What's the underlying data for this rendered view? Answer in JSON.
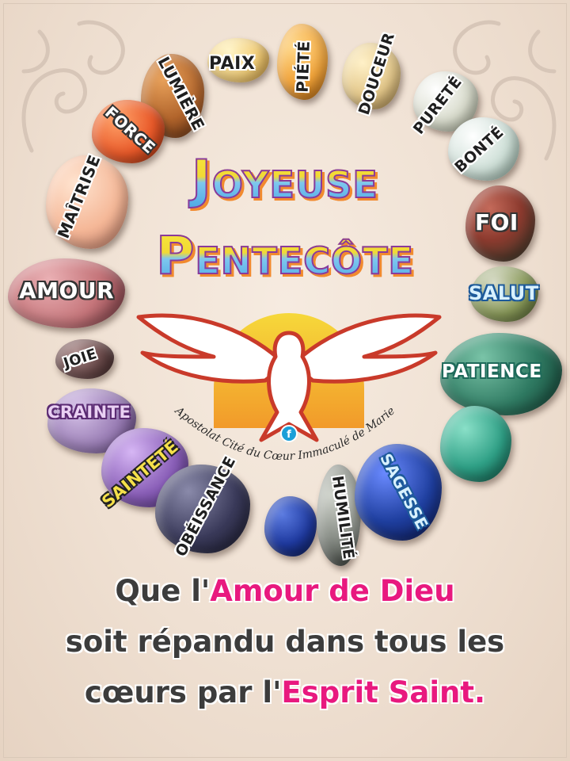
{
  "title": {
    "line1": "Joyeuse",
    "line2": "Pentecôte"
  },
  "organization": "Apostolat Cité du Cœur Immaculé de Marie",
  "virtues": [
    {
      "key": "paix",
      "label": "PAIX",
      "color": "#f3cf7a"
    },
    {
      "key": "piete",
      "label": "PIÉTÉ",
      "color": "#f2a43a"
    },
    {
      "key": "douceur",
      "label": "DOUCEUR",
      "color": "#e3c78a"
    },
    {
      "key": "lumiere",
      "label": "LUMIÈRE",
      "color": "#b2652c"
    },
    {
      "key": "force",
      "label": "FORCE",
      "color": "#e95a2a"
    },
    {
      "key": "purete",
      "label": "PURETÉ",
      "color": "#d9dccd"
    },
    {
      "key": "bonte",
      "label": "BONTÉ",
      "color": "#cfe0d8"
    },
    {
      "key": "maitrise",
      "label": "MAÎTRISE",
      "color": "#f5b898"
    },
    {
      "key": "foi",
      "label": "FOI",
      "color": "#8c3a2e"
    },
    {
      "key": "salut",
      "label": "SALUT",
      "color": "#8a9a5a"
    },
    {
      "key": "amour",
      "label": "AMOUR",
      "color": "#c5757a"
    },
    {
      "key": "joie",
      "label": "JOIE",
      "color": "#6a4a4a"
    },
    {
      "key": "patience",
      "label": "PATIENCE",
      "color": "#2f7a62"
    },
    {
      "key": "crainte",
      "label": "CRAINTE",
      "color": "#9b7fb6"
    },
    {
      "key": "saintete",
      "label": "SAINTETÉ",
      "color": "#8a5fb8"
    },
    {
      "key": "obeissance",
      "label": "OBÉISSANCE",
      "color": "#3a3a5a"
    },
    {
      "key": "humilite",
      "label": "HUMILITÉ",
      "color": "#8a8f88"
    },
    {
      "key": "sagesse",
      "label": "SAGESSE",
      "color": "#1f3f9f"
    }
  ],
  "message": {
    "line1_before": "Que l'",
    "line1_highlight": "Amour de Dieu",
    "line2": "soit répandu dans tous les",
    "line3_before": "cœurs par l'",
    "line3_highlight": "Esprit Saint.",
    "highlight_color": "#e8197f",
    "text_color": "#3c3c3c"
  }
}
